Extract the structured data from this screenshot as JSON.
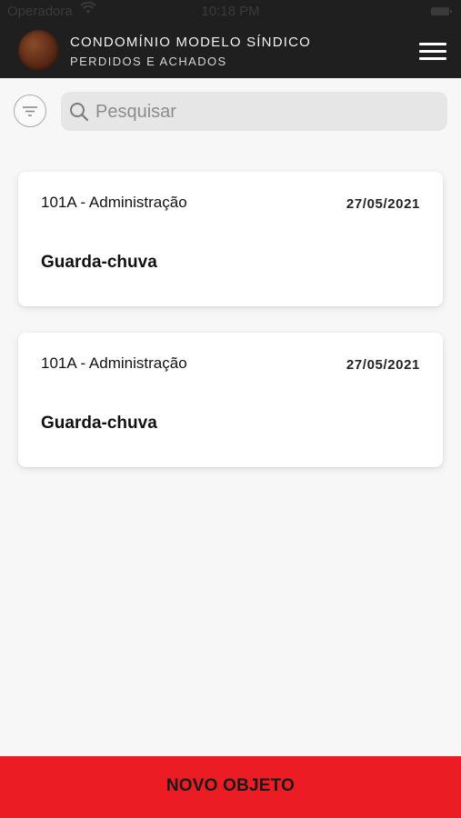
{
  "status_bar": {
    "carrier": "Operadora",
    "time": "10:18 PM"
  },
  "header": {
    "title": "CONDOMÍNIO MODELO SÍNDICO",
    "subtitle": "PERDIDOS E ACHADOS",
    "menu_icon": "hamburger-menu-icon"
  },
  "toolbar": {
    "filter_icon": "filter-icon",
    "search": {
      "placeholder": "Pesquisar",
      "value": ""
    }
  },
  "items": [
    {
      "unit": "101A - Administração",
      "date": "27/05/2021",
      "name": "Guarda-chuva"
    },
    {
      "unit": "101A - Administração",
      "date": "27/05/2021",
      "name": "Guarda-chuva"
    }
  ],
  "footer": {
    "new_object_label": "NOVO OBJETO",
    "accent_color": "#ec1c24"
  }
}
